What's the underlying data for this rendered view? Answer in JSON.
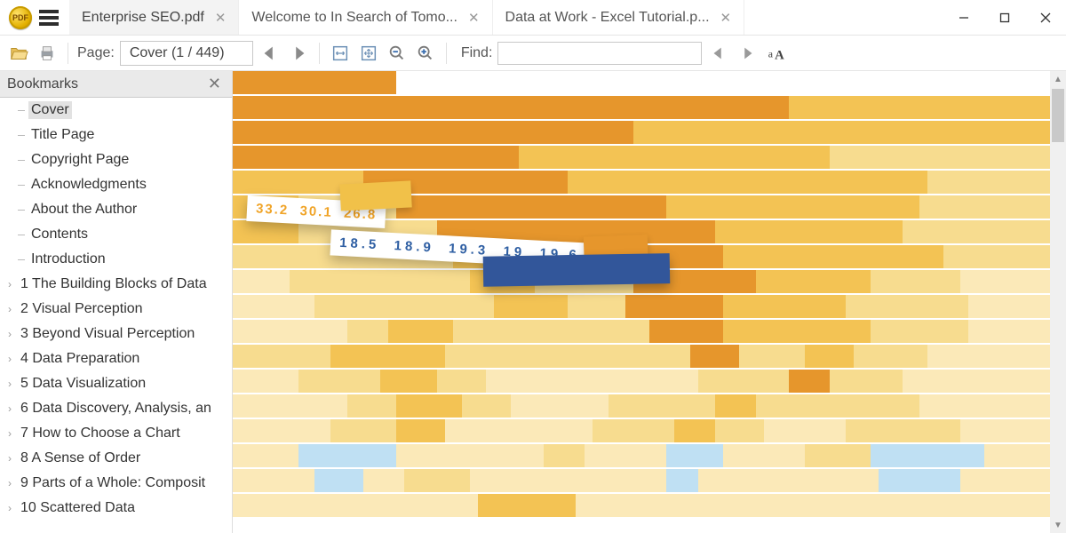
{
  "app": {
    "icon_text": "PDF"
  },
  "tabs": [
    {
      "label": "Enterprise SEO.pdf",
      "active": true
    },
    {
      "label": "Welcome to In Search of Tomo...",
      "active": false
    },
    {
      "label": "Data at Work - Excel Tutorial.p...",
      "active": false
    }
  ],
  "toolbar": {
    "page_label": "Page:",
    "page_value": "Cover  (1 / 449)",
    "find_label": "Find:",
    "find_value": ""
  },
  "sidebar": {
    "title": "Bookmarks",
    "items": [
      {
        "label": "Cover",
        "expandable": false,
        "selected": true
      },
      {
        "label": "Title Page",
        "expandable": false
      },
      {
        "label": "Copyright Page",
        "expandable": false
      },
      {
        "label": "Acknowledgments",
        "expandable": false
      },
      {
        "label": "About the Author",
        "expandable": false
      },
      {
        "label": "Contents",
        "expandable": false
      },
      {
        "label": "Introduction",
        "expandable": false
      },
      {
        "label": "1 The Building Blocks of Data",
        "expandable": true
      },
      {
        "label": "2 Visual Perception",
        "expandable": true
      },
      {
        "label": "3 Beyond Visual Perception",
        "expandable": true
      },
      {
        "label": "4 Data Preparation",
        "expandable": true
      },
      {
        "label": "5 Data Visualization",
        "expandable": true
      },
      {
        "label": "6 Data Discovery, Analysis, an",
        "expandable": true
      },
      {
        "label": "7 How to Choose a Chart",
        "expandable": true
      },
      {
        "label": "8 A Sense of Order",
        "expandable": true
      },
      {
        "label": "9 Parts of a Whole: Composit",
        "expandable": true
      },
      {
        "label": "10 Scattered Data",
        "expandable": true
      }
    ]
  },
  "cover": {
    "torn_top_values": [
      "33.2",
      "30.1",
      "26.8"
    ],
    "torn_bottom_values": [
      "18.5",
      "18.9",
      "19.3",
      "19",
      "19.6"
    ]
  },
  "chart_data": {
    "type": "bar",
    "title": "",
    "xlabel": "",
    "ylabel": "",
    "note": "Decorative stacked horizontal bars on book cover; no axes. Percent widths per band, ordered left→right.",
    "palette": {
      "dark": "#e6962c",
      "mid": "#f3c354",
      "light": "#f7dc8f",
      "pale": "#fbe9b8",
      "blue": "#bfe0f3"
    },
    "rows": [
      {
        "segs": [
          [
            "dark",
            20
          ]
        ]
      },
      {
        "segs": [
          [
            "dark",
            68
          ],
          [
            "mid",
            32
          ]
        ]
      },
      {
        "segs": [
          [
            "dark",
            49
          ],
          [
            "mid",
            51
          ]
        ]
      },
      {
        "segs": [
          [
            "dark",
            35
          ],
          [
            "mid",
            38
          ],
          [
            "light",
            27
          ]
        ]
      },
      {
        "segs": [
          [
            "mid",
            16
          ],
          [
            "dark",
            25
          ],
          [
            "mid",
            44
          ],
          [
            "light",
            15
          ]
        ]
      },
      {
        "segs": [
          [
            "mid",
            8
          ],
          [
            "light",
            12
          ],
          [
            "dark",
            33
          ],
          [
            "mid",
            31
          ],
          [
            "light",
            16
          ]
        ]
      },
      {
        "segs": [
          [
            "mid",
            8
          ],
          [
            "light",
            17
          ],
          [
            "dark",
            34
          ],
          [
            "mid",
            23
          ],
          [
            "light",
            18
          ]
        ]
      },
      {
        "segs": [
          [
            "light",
            27
          ],
          [
            "mid",
            4
          ],
          [
            "light",
            8
          ],
          [
            "dark",
            21
          ],
          [
            "mid",
            27
          ],
          [
            "light",
            13
          ]
        ]
      },
      {
        "segs": [
          [
            "pale",
            7
          ],
          [
            "light",
            22
          ],
          [
            "mid",
            8
          ],
          [
            "light",
            12
          ],
          [
            "dark",
            15
          ],
          [
            "mid",
            14
          ],
          [
            "light",
            11
          ],
          [
            "pale",
            11
          ]
        ]
      },
      {
        "segs": [
          [
            "pale",
            10
          ],
          [
            "light",
            22
          ],
          [
            "mid",
            9
          ],
          [
            "light",
            7
          ],
          [
            "dark",
            12
          ],
          [
            "mid",
            15
          ],
          [
            "light",
            15
          ],
          [
            "pale",
            10
          ]
        ]
      },
      {
        "segs": [
          [
            "pale",
            14
          ],
          [
            "light",
            5
          ],
          [
            "mid",
            8
          ],
          [
            "light",
            24
          ],
          [
            "dark",
            9
          ],
          [
            "mid",
            18
          ],
          [
            "light",
            12
          ],
          [
            "pale",
            10
          ]
        ]
      },
      {
        "segs": [
          [
            "light",
            12
          ],
          [
            "mid",
            14
          ],
          [
            "light",
            30
          ],
          [
            "dark",
            6
          ],
          [
            "light",
            8
          ],
          [
            "mid",
            6
          ],
          [
            "light",
            9
          ],
          [
            "pale",
            15
          ]
        ]
      },
      {
        "segs": [
          [
            "pale",
            8
          ],
          [
            "light",
            10
          ],
          [
            "mid",
            7
          ],
          [
            "light",
            6
          ],
          [
            "pale",
            26
          ],
          [
            "light",
            11
          ],
          [
            "dark",
            5
          ],
          [
            "light",
            9
          ],
          [
            "pale",
            18
          ]
        ]
      },
      {
        "segs": [
          [
            "pale",
            14
          ],
          [
            "light",
            6
          ],
          [
            "mid",
            8
          ],
          [
            "light",
            6
          ],
          [
            "pale",
            12
          ],
          [
            "light",
            13
          ],
          [
            "mid",
            5
          ],
          [
            "light",
            20
          ],
          [
            "pale",
            16
          ]
        ]
      },
      {
        "segs": [
          [
            "pale",
            12
          ],
          [
            "light",
            8
          ],
          [
            "mid",
            6
          ],
          [
            "pale",
            18
          ],
          [
            "light",
            10
          ],
          [
            "mid",
            5
          ],
          [
            "light",
            6
          ],
          [
            "pale",
            10
          ],
          [
            "light",
            14
          ],
          [
            "pale",
            11
          ]
        ]
      },
      {
        "segs": [
          [
            "pale",
            8
          ],
          [
            "blue",
            12
          ],
          [
            "pale",
            18
          ],
          [
            "light",
            5
          ],
          [
            "pale",
            10
          ],
          [
            "blue",
            7
          ],
          [
            "pale",
            10
          ],
          [
            "light",
            8
          ],
          [
            "blue",
            14
          ],
          [
            "pale",
            8
          ]
        ]
      },
      {
        "segs": [
          [
            "pale",
            10
          ],
          [
            "blue",
            6
          ],
          [
            "pale",
            5
          ],
          [
            "light",
            8
          ],
          [
            "pale",
            24
          ],
          [
            "blue",
            4
          ],
          [
            "pale",
            22
          ],
          [
            "blue",
            10
          ],
          [
            "pale",
            11
          ]
        ]
      },
      {
        "segs": [
          [
            "pale",
            30
          ],
          [
            "mid",
            12
          ],
          [
            "pale",
            58
          ]
        ]
      }
    ]
  }
}
